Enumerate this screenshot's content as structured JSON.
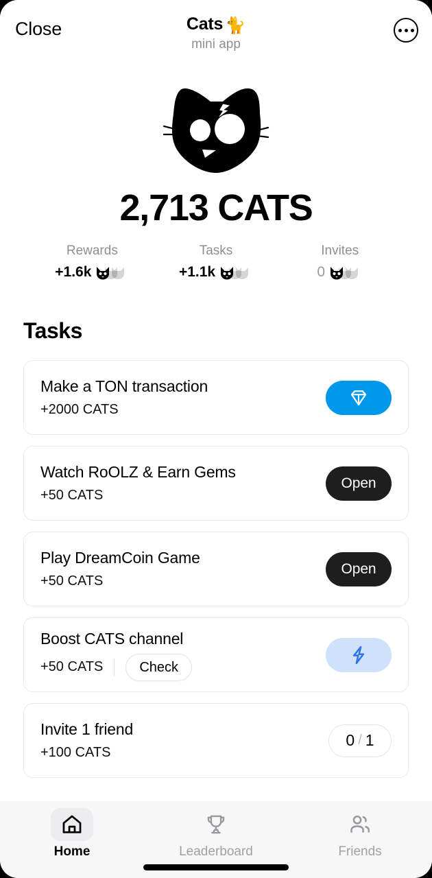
{
  "header": {
    "close_label": "Close",
    "app_title": "Cats",
    "app_emoji": "🐈",
    "app_subtitle": "mini app",
    "more_icon": "more-options-icon"
  },
  "hero": {
    "logo_icon": "cat-head-logo",
    "balance": "2,713 CATS"
  },
  "stats": [
    {
      "label": "Rewards",
      "value": "+1.6k",
      "muted": false,
      "icon": "cat-coin-icon"
    },
    {
      "label": "Tasks",
      "value": "+1.1k",
      "muted": false,
      "icon": "cat-coin-icon"
    },
    {
      "label": "Invites",
      "value": "0",
      "muted": true,
      "icon": "cat-coin-icon"
    }
  ],
  "tasks_section": {
    "heading": "Tasks",
    "items": [
      {
        "title": "Make a TON transaction",
        "reward": "+2000 CATS",
        "action_type": "ton",
        "action_icon": "ton-diamond-icon",
        "action_label": ""
      },
      {
        "title": "Watch RoOLZ & Earn Gems",
        "reward": "+50 CATS",
        "action_type": "open",
        "action_label": "Open"
      },
      {
        "title": "Play DreamCoin Game",
        "reward": "+50 CATS",
        "action_type": "open",
        "action_label": "Open"
      },
      {
        "title": "Boost CATS channel",
        "reward": "+50 CATS",
        "check_label": "Check",
        "action_type": "boost",
        "action_icon": "lightning-bolt-icon",
        "action_label": ""
      },
      {
        "title": "Invite 1 friend",
        "reward": "+100 CATS",
        "action_type": "count",
        "count_current": "0",
        "count_separator": "/",
        "count_total": "1"
      }
    ]
  },
  "bottom_nav": {
    "items": [
      {
        "label": "Home",
        "icon": "home-icon",
        "active": true
      },
      {
        "label": "Leaderboard",
        "icon": "trophy-icon",
        "active": false
      },
      {
        "label": "Friends",
        "icon": "people-icon",
        "active": false
      }
    ]
  },
  "colors": {
    "ton_blue": "#0098EA",
    "boost_blue_bg": "#CFE1FB",
    "boost_blue_icon": "#2F73E8",
    "dark_button": "#1E1E1E",
    "muted_text": "#8E8E93"
  }
}
